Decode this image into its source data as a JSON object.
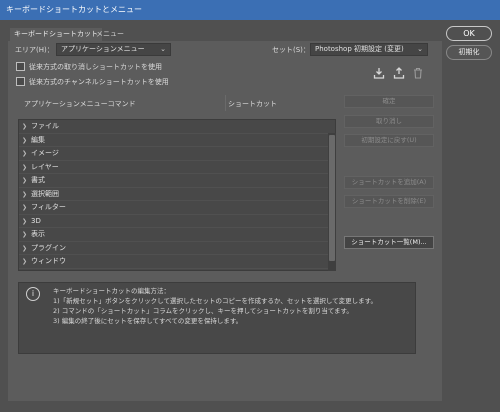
{
  "window": {
    "title": "キーボードショートカットとメニュー"
  },
  "tabs": [
    {
      "label": "キーボードショートカット",
      "active": true
    },
    {
      "label": "メニュー",
      "active": false
    }
  ],
  "area": {
    "label": "エリア(H)：",
    "value": "アプリケーションメニュー"
  },
  "set": {
    "label": "セット(S)：",
    "value": "Photoshop 初期設定 (変更)"
  },
  "options": [
    {
      "label": "従来方式の取り消しショートカットを使用",
      "checked": false
    },
    {
      "label": "従来方式のチャンネルショートカットを使用",
      "checked": false
    }
  ],
  "toolbar_icons": [
    "save-set-icon",
    "new-set-icon",
    "trash-icon"
  ],
  "columns": {
    "command": "アプリケーションメニューコマンド",
    "shortcut": "ショートカット"
  },
  "menu_items": [
    "ファイル",
    "編集",
    "イメージ",
    "レイヤー",
    "書式",
    "選択範囲",
    "フィルター",
    "3D",
    "表示",
    "プラグイン",
    "ウィンドウ"
  ],
  "side_buttons": {
    "accept": "確定",
    "undo": "取り消し",
    "reset": "初期設定に戻す(U)",
    "add": "ショートカットを追加(A)",
    "delete": "ショートカットを削除(E)",
    "summary": "ショートカット一覧(M)..."
  },
  "dialog_buttons": {
    "ok": "OK",
    "reset": "初期化"
  },
  "info": {
    "lines": [
      "キーボードショートカットの編集方法：",
      "1)「新規セット」ボタンをクリックして選択したセットのコピーを作成するか、セットを選択して変更します。",
      "2) コマンドの「ショートカット」コラムをクリックし、キーを押してショートカットを割り当てます。",
      "3) 編集の終了後にセットを保存してすべての変更を保持します。"
    ]
  },
  "colors": {
    "titlebar": "#3b6fb4",
    "dialog_bg": "#505050",
    "panel_bg": "#5c5c5c",
    "list_bg": "#484848"
  }
}
